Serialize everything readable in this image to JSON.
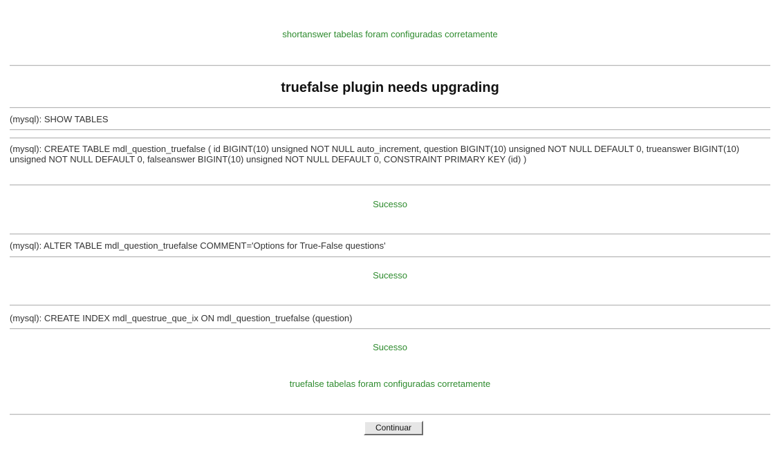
{
  "messages": {
    "shortanswer_done": "shortanswer tabelas foram configuradas corretamente",
    "truefalse_done": "truefalse tabelas foram configuradas corretamente"
  },
  "heading": "truefalse plugin needs upgrading",
  "sql": {
    "show_tables": "(mysql): SHOW TABLES",
    "create_table": "(mysql): CREATE TABLE mdl_question_truefalse ( id BIGINT(10) unsigned NOT NULL auto_increment, question BIGINT(10) unsigned NOT NULL DEFAULT 0, trueanswer BIGINT(10) unsigned NOT NULL DEFAULT 0, falseanswer BIGINT(10) unsigned NOT NULL DEFAULT 0, CONSTRAINT PRIMARY KEY (id) )",
    "alter_table": "(mysql): ALTER TABLE mdl_question_truefalse COMMENT='Options for True-False questions'",
    "create_index": "(mysql): CREATE INDEX mdl_questrue_que_ix ON mdl_question_truefalse (question)"
  },
  "results": {
    "create_table": "Sucesso",
    "alter_table": "Sucesso",
    "create_index": "Sucesso"
  },
  "buttons": {
    "continue_label": "Continuar"
  },
  "colors": {
    "success_text": "#2e8b2e",
    "body_text": "#333333",
    "rule": "#b8b8b8"
  }
}
